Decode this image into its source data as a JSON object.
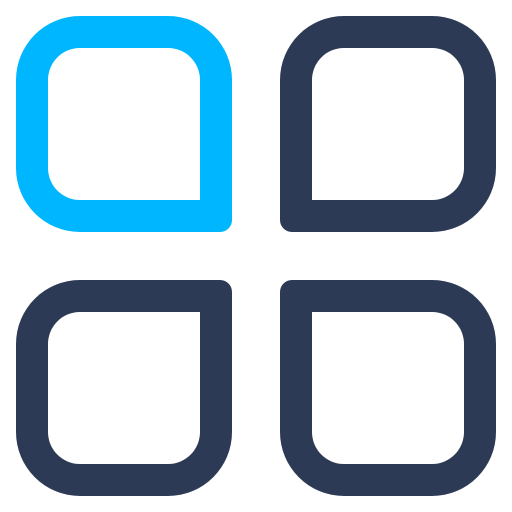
{
  "icon": {
    "name": "grid-apps-icon",
    "colors": {
      "accent": "#00B6FF",
      "base": "#2C3A56",
      "background": "#FFFFFF"
    },
    "tiles": [
      {
        "id": "top-left",
        "color_role": "accent",
        "square_corner": "bottom-right"
      },
      {
        "id": "top-right",
        "color_role": "base",
        "square_corner": "bottom-left"
      },
      {
        "id": "bottom-left",
        "color_role": "base",
        "square_corner": "top-right"
      },
      {
        "id": "bottom-right",
        "color_role": "base",
        "square_corner": "top-left"
      }
    ]
  }
}
